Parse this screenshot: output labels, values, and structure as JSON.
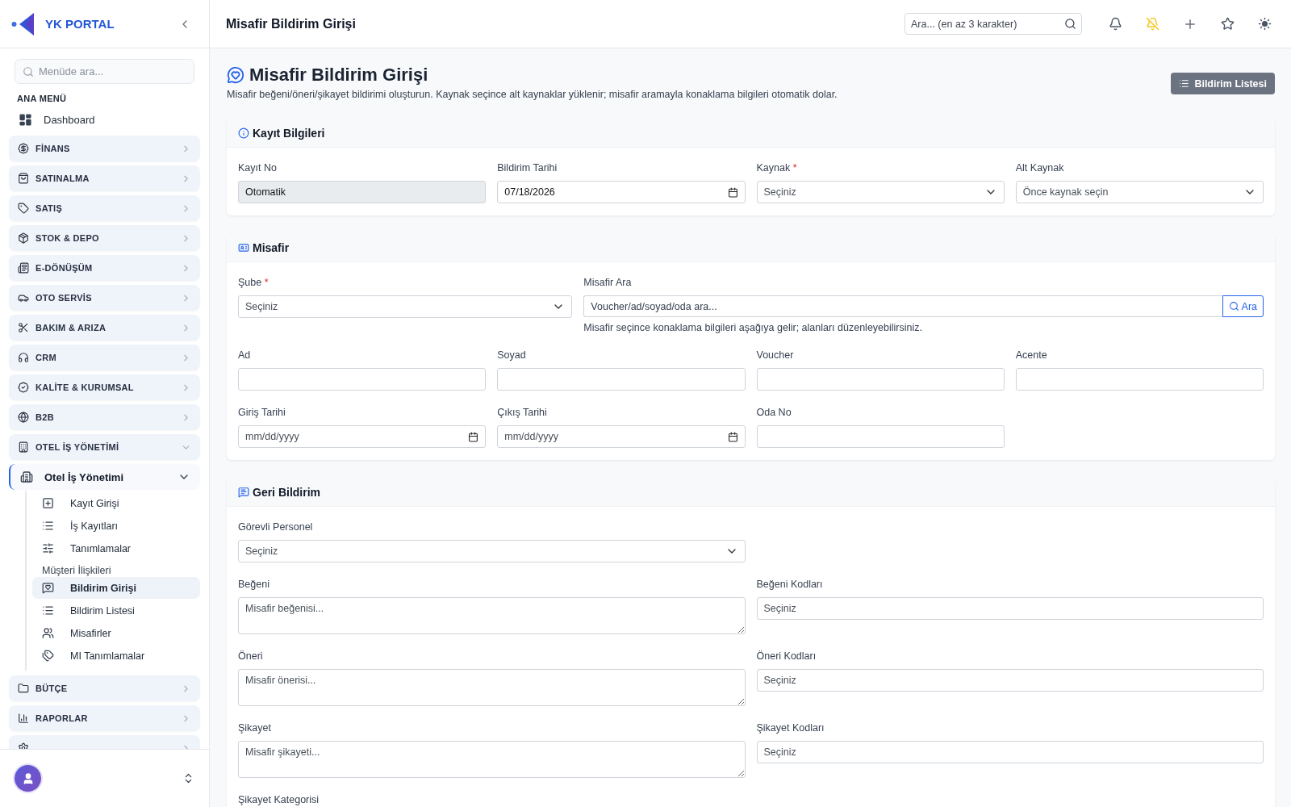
{
  "brand": "YK PORTAL",
  "sidebar": {
    "search": {
      "placeholder": "Menüde ara..."
    },
    "section_title": "ANA MENÜ",
    "dashboard": "Dashboard",
    "groups": [
      {
        "label": "FİNANS",
        "expanded": false
      },
      {
        "label": "SATINALMA",
        "expanded": false
      },
      {
        "label": "SATIŞ",
        "expanded": false
      },
      {
        "label": "STOK & DEPO",
        "expanded": false
      },
      {
        "label": "E-DÖNÜŞÜM",
        "expanded": false
      },
      {
        "label": "OTO SERVİS",
        "expanded": false
      },
      {
        "label": "BAKIM & ARIZA",
        "expanded": false
      },
      {
        "label": "CRM",
        "expanded": false
      },
      {
        "label": "KALİTE & KURUMSAL",
        "expanded": false
      },
      {
        "label": "B2B",
        "expanded": false
      },
      {
        "label": "OTEL İŞ YÖNETİMİ",
        "expanded": true,
        "children": [
          {
            "label": "Otel İş Yönetimi",
            "expanded": true,
            "items": [
              {
                "kind": "link",
                "label": "Kayıt Girişi",
                "selected": false
              },
              {
                "kind": "link",
                "label": "İş Kayıtları",
                "selected": false
              },
              {
                "kind": "link",
                "label": "Tanımlamalar",
                "selected": false
              },
              {
                "kind": "heading",
                "label": "Müşteri İlişkileri"
              },
              {
                "kind": "link",
                "label": "Bildirim Girişi",
                "selected": true
              },
              {
                "kind": "link",
                "label": "Bildirim Listesi",
                "selected": false
              },
              {
                "kind": "link",
                "label": "Misafirler",
                "selected": false
              },
              {
                "kind": "link",
                "label": "MI Tanımlamalar",
                "selected": false
              }
            ]
          }
        ]
      },
      {
        "label": "BÜTÇE",
        "expanded": false
      },
      {
        "label": "RAPORLAR",
        "expanded": false
      },
      {
        "expanded": false
      }
    ]
  },
  "header": {
    "title": "Misafir Bildirim Girişi",
    "search": {
      "placeholder": "Ara... (en az 3 karakter)"
    }
  },
  "page": {
    "title": "Misafir Bildirim Girişi",
    "description": "Misafir beğeni/öneri/şikayet bildirimi oluşturun. Kaynak seçince alt kaynaklar yüklenir; misafir aramayla konaklama bilgileri otomatik dolar.",
    "list_button": "Bildirim Listesi"
  },
  "sections": [
    {
      "title": "Kayıt Bilgileri",
      "fields": [
        {
          "kind": "text",
          "label": "Kayıt No",
          "value": "Otomatik",
          "disabled": true
        },
        {
          "kind": "date",
          "label": "Bildirim Tarihi",
          "value": "07/18/2026",
          "disabled": false
        },
        {
          "kind": "select",
          "label": "Kaynak",
          "placeholder": "Seçiniz",
          "required_mark": "*",
          "disabled": false
        },
        {
          "kind": "select",
          "label": "Alt Kaynak",
          "placeholder": "Önce kaynak seçin",
          "disabled": false
        }
      ]
    },
    {
      "title": "Misafir",
      "fields": [
        {
          "kind": "select",
          "label": "Şube",
          "placeholder": "Seçiniz",
          "required_mark": "*",
          "disabled": false
        },
        {
          "kind": "search",
          "label": "Misafir Ara",
          "placeholder": "Voucher/ad/soyad/oda ara...",
          "button": "Ara",
          "hint": "Misafir seçince konaklama bilgileri aşağıya gelir; alanları düzenleyebilirsiniz.",
          "disabled": false
        },
        {
          "kind": "text",
          "label": "Ad",
          "disabled": false
        },
        {
          "kind": "text",
          "label": "Soyad",
          "disabled": false
        },
        {
          "kind": "text",
          "label": "Voucher",
          "disabled": false
        },
        {
          "kind": "text",
          "label": "Acente",
          "disabled": false
        },
        {
          "kind": "date",
          "label": "Giriş Tarihi",
          "placeholder": "mm/dd/yyyy",
          "disabled": false
        },
        {
          "kind": "date",
          "label": "Çıkış Tarihi",
          "placeholder": "mm/dd/yyyy",
          "disabled": false
        },
        {
          "kind": "text",
          "label": "Oda No",
          "disabled": false
        }
      ]
    },
    {
      "title": "Geri Bildirim",
      "fields": [
        {
          "kind": "select",
          "label": "Görevli Personel",
          "placeholder": "Seçiniz",
          "disabled": false
        },
        {
          "kind": "textarea",
          "label": "Beğeni",
          "placeholder": "Misafir beğenisi...",
          "disabled": false
        },
        {
          "kind": "codes",
          "label": "Beğeni Kodları",
          "placeholder": "Seçiniz",
          "disabled": false
        },
        {
          "kind": "textarea",
          "label": "Öneri",
          "placeholder": "Misafir önerisi...",
          "disabled": false
        },
        {
          "kind": "codes",
          "label": "Öneri Kodları",
          "placeholder": "Seçiniz",
          "disabled": false
        },
        {
          "kind": "textarea",
          "label": "Şikayet",
          "placeholder": "Misafir şikayeti...",
          "disabled": false
        },
        {
          "kind": "codes",
          "label": "Şikayet Kodları",
          "placeholder": "Seçiniz",
          "disabled": false
        },
        {
          "kind": "label",
          "label": "Şikayet Kategorisi"
        }
      ]
    }
  ]
}
